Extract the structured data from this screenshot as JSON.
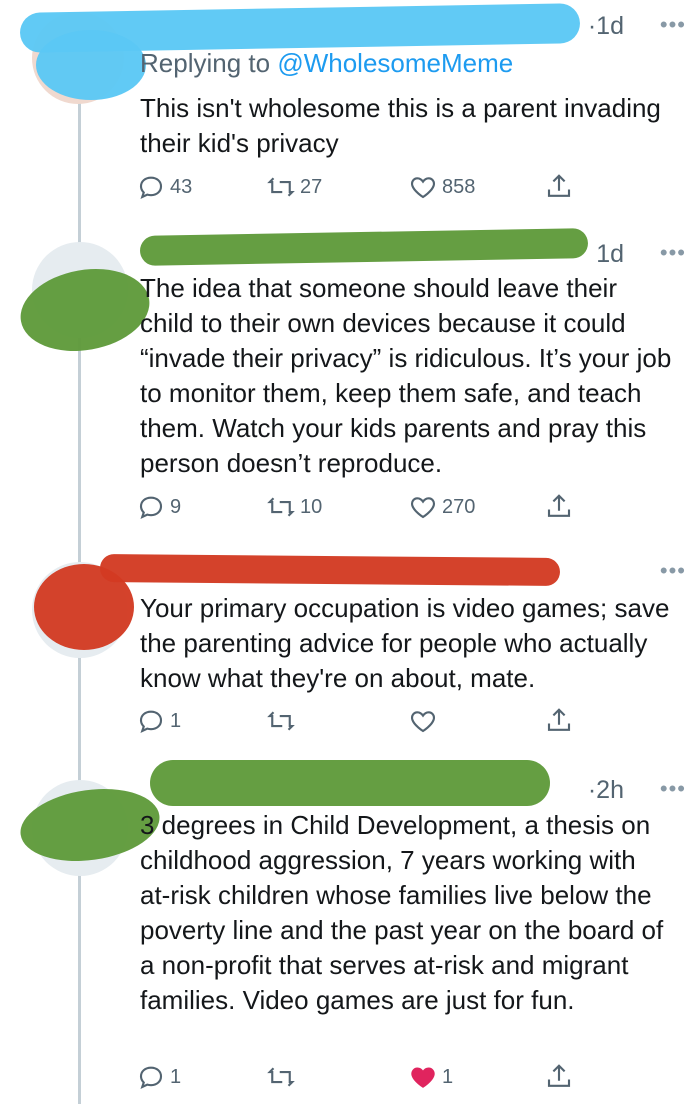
{
  "tweets": [
    {
      "time": "·1d",
      "reply_prefix": "Replying to ",
      "reply_handle": "@WholesomeMeme",
      "text": "This isn't wholesome this is a parent invading their kid's privacy",
      "replies": "43",
      "retweets": "27",
      "likes": "858"
    },
    {
      "time": "1d",
      "text": "The idea that someone should leave their child to their own devices because it could “invade their privacy” is ridiculous. It’s your job to monitor them, keep them safe, and teach them. Watch your kids parents and pray this person doesn’t reproduce.",
      "replies": "9",
      "retweets": "10",
      "likes": "270"
    },
    {
      "time": "",
      "text": "Your primary occupation is video games; save the parenting advice for people who actually know what they're on about, mate.",
      "replies": "1",
      "retweets": "",
      "likes": ""
    },
    {
      "time": "·2h",
      "text": "3 degrees in Child Development, a thesis on childhood aggression, 7 years working with at-risk children whose families live below the poverty line and the past year on the board of a non-profit that serves at-risk and migrant families. Video games are just for fun.",
      "replies": "1",
      "retweets": "",
      "likes": "1"
    }
  ],
  "icons": {
    "more": "more-horizontal-icon",
    "reply": "reply-bubble-icon",
    "retweet": "retweet-icon",
    "like": "heart-icon",
    "share": "share-icon"
  },
  "colors": {
    "blue_scribble": "#5bc8f5",
    "green_scribble": "#5f9a3a",
    "red_scribble": "#d23a22",
    "liked_heart": "#e0245e",
    "link": "#1d9bf0"
  }
}
